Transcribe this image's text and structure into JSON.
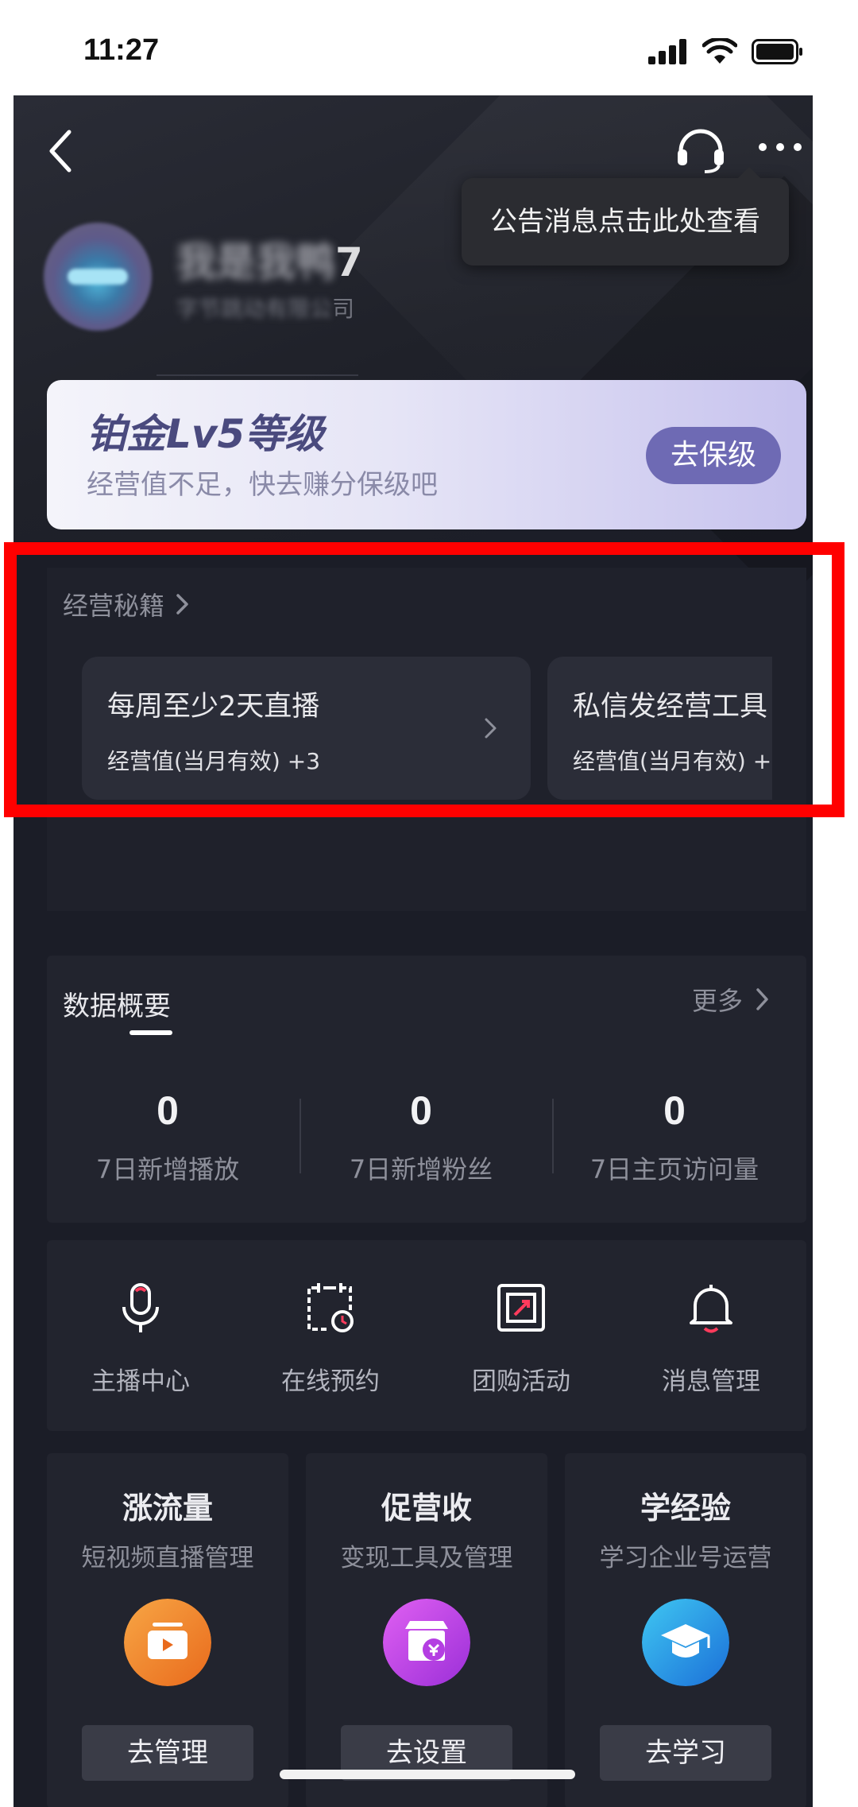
{
  "status_bar": {
    "time": "11:27"
  },
  "header": {
    "tooltip": "公告消息点击此处查看"
  },
  "profile": {
    "name_blurred": "我是我鸭",
    "name_suffix": "7",
    "company_blurred": "字节跳动有限公",
    "company_suffix": "司"
  },
  "level_card": {
    "title": "铂金Lv5等级",
    "subtitle": "经营值不足，快去赚分保级吧",
    "button": "去保级"
  },
  "tips": {
    "header": "经营秘籍",
    "cards": [
      {
        "title": "每周至少2天直播",
        "value": "经营值(当月有效) +3"
      },
      {
        "title": "私信发经营工具",
        "value": "经营值(当月有效) +"
      }
    ]
  },
  "data_overview": {
    "title": "数据概要",
    "more": "更多",
    "stats": [
      {
        "value": "0",
        "label": "7日新增播放"
      },
      {
        "value": "0",
        "label": "7日新增粉丝"
      },
      {
        "value": "0",
        "label": "7日主页访问量"
      }
    ]
  },
  "tools": [
    {
      "label": "主播中心",
      "icon": "microphone-icon"
    },
    {
      "label": "在线预约",
      "icon": "calendar-clock-icon"
    },
    {
      "label": "团购活动",
      "icon": "coupon-icon"
    },
    {
      "label": "消息管理",
      "icon": "bell-icon"
    }
  ],
  "features": [
    {
      "title": "涨流量",
      "subtitle": "短视频直播管理",
      "button": "去管理",
      "icon": "video-play-icon",
      "color": "#f08a2c"
    },
    {
      "title": "促营收",
      "subtitle": "变现工具及管理",
      "button": "去设置",
      "icon": "store-icon",
      "color": "#c347e8"
    },
    {
      "title": "学经验",
      "subtitle": "学习企业号运营",
      "button": "去学习",
      "icon": "graduation-cap-icon",
      "color": "#2b8fe6"
    }
  ],
  "colors": {
    "highlight": "#ff0000",
    "background": "#1b1d27",
    "level_button": "#6e6ab4"
  }
}
